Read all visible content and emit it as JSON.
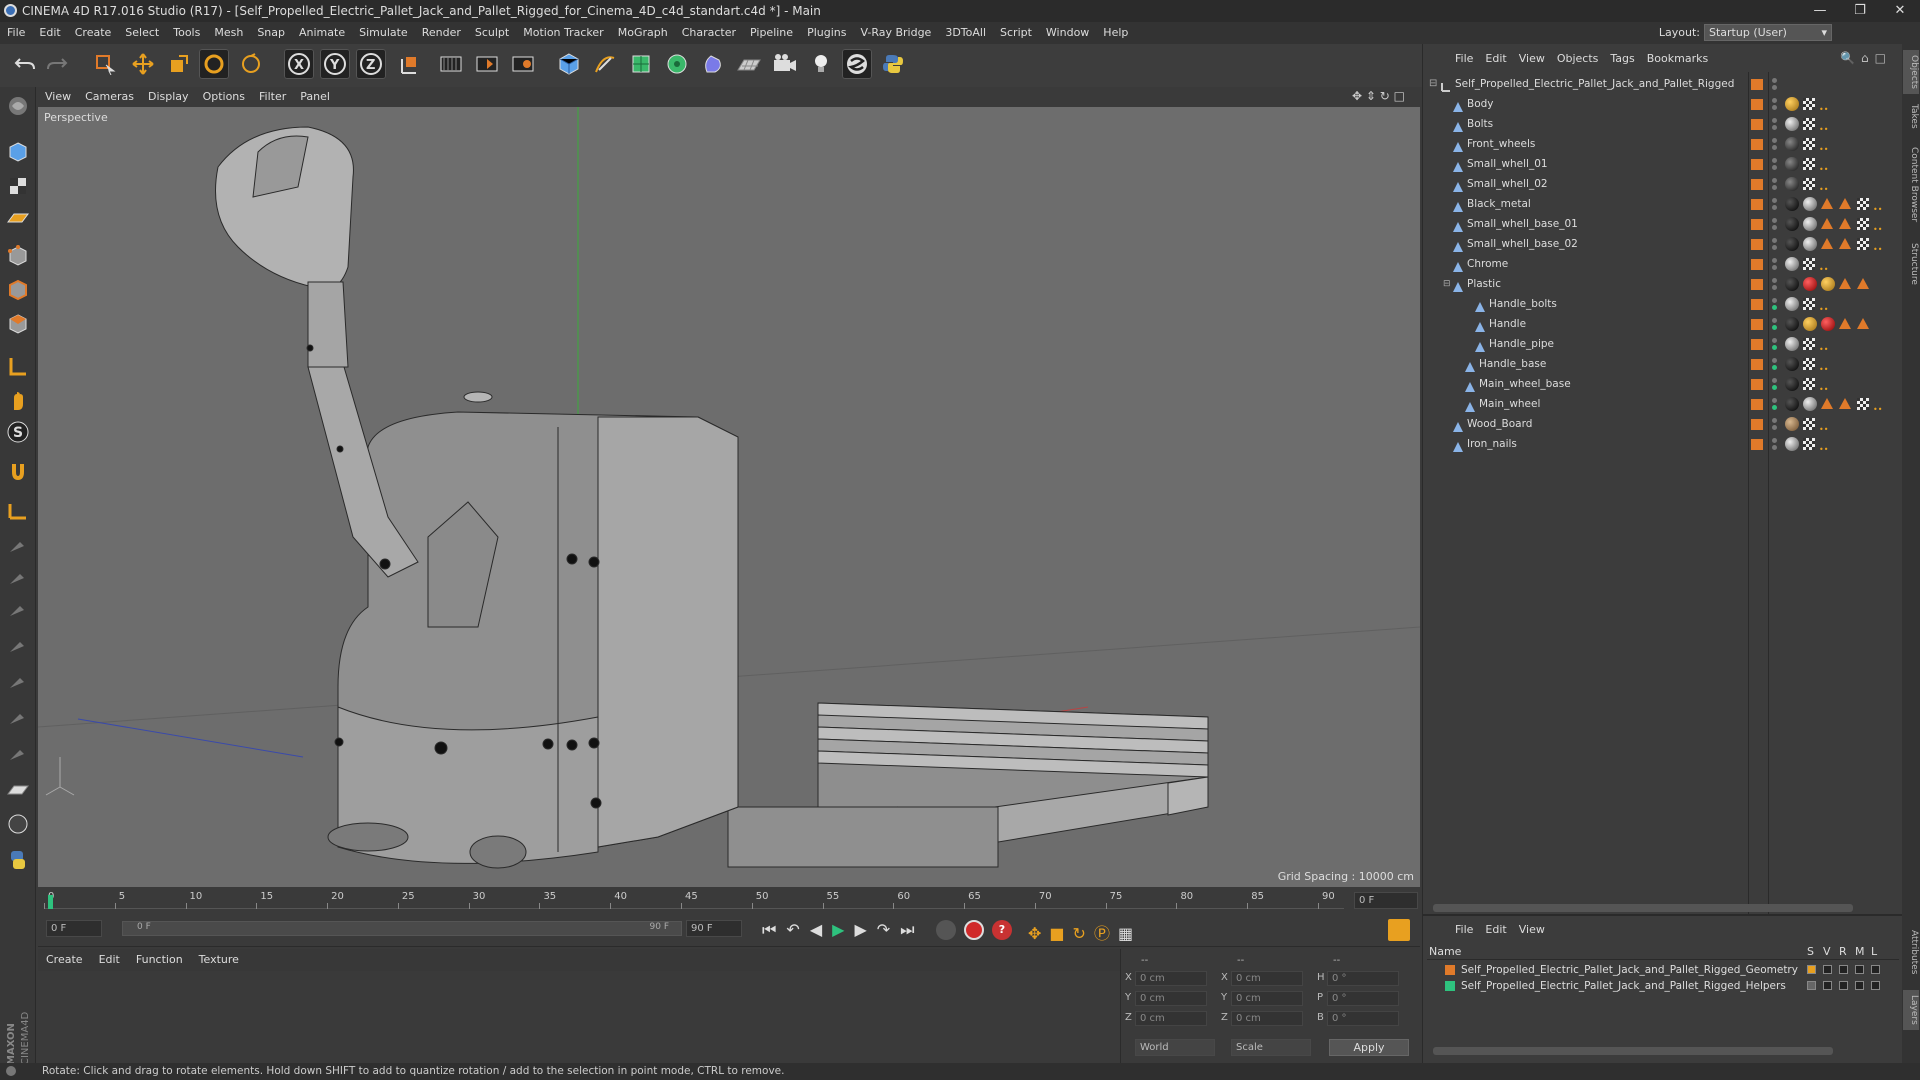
{
  "app": {
    "title": "CINEMA 4D R17.016 Studio (R17) - [Self_Propelled_Electric_Pallet_Jack_and_Pallet_Rigged_for_Cinema_4D_c4d_standart.c4d *] - Main",
    "layout_label": "Layout:",
    "layout_value": "Startup (User)"
  },
  "menubar": [
    "File",
    "Edit",
    "Create",
    "Select",
    "Tools",
    "Mesh",
    "Snap",
    "Animate",
    "Simulate",
    "Render",
    "Sculpt",
    "Motion Tracker",
    "MoGraph",
    "Character",
    "Pipeline",
    "Plugins",
    "V-Ray Bridge",
    "3DToAll",
    "Script",
    "Window",
    "Help"
  ],
  "viewport": {
    "menu": [
      "View",
      "Cameras",
      "Display",
      "Options",
      "Filter",
      "Panel"
    ],
    "label": "Perspective",
    "grid_spacing": "Grid Spacing : 10000 cm"
  },
  "timeline": {
    "ticks": [
      "0",
      "5",
      "10",
      "15",
      "20",
      "25",
      "30",
      "35",
      "40",
      "45",
      "50",
      "55",
      "60",
      "65",
      "70",
      "75",
      "80",
      "85",
      "90"
    ],
    "current_frame": "0 F",
    "start_field": "0 F",
    "range_left": "0 F",
    "range_right": "90 F",
    "end_field": "90 F"
  },
  "material_menu": [
    "Create",
    "Edit",
    "Function",
    "Texture"
  ],
  "coords": {
    "header": [
      "--",
      "--",
      "--"
    ],
    "rows": [
      {
        "a": "X",
        "v1": "0 cm",
        "b": "X",
        "v2": "0 cm",
        "c": "H",
        "v3": "0 °"
      },
      {
        "a": "Y",
        "v1": "0 cm",
        "b": "Y",
        "v2": "0 cm",
        "c": "P",
        "v3": "0 °"
      },
      {
        "a": "Z",
        "v1": "0 cm",
        "b": "Z",
        "v2": "0 cm",
        "c": "B",
        "v3": "0 °"
      }
    ],
    "space": "World",
    "mode": "Scale",
    "apply": "Apply"
  },
  "status": "Rotate: Click and drag to rotate elements. Hold down SHIFT to add to quantize rotation / add to the selection in point mode, CTRL to remove.",
  "object_manager": {
    "menu": [
      "File",
      "Edit",
      "View",
      "Objects",
      "Tags",
      "Bookmarks"
    ],
    "objects": [
      {
        "name": "Self_Propelled_Electric_Pallet_Jack_and_Pallet_Rigged",
        "depth": 0,
        "tags": []
      },
      {
        "name": "Body",
        "depth": 1,
        "tags": [
          "gold",
          "chk"
        ]
      },
      {
        "name": "Bolts",
        "depth": 1,
        "tags": [
          "grey",
          "chk"
        ]
      },
      {
        "name": "Front_wheels",
        "depth": 1,
        "tags": [
          "dark",
          "chk"
        ]
      },
      {
        "name": "Small_whell_01",
        "depth": 1,
        "tags": [
          "dark",
          "chk"
        ]
      },
      {
        "name": "Small_whell_02",
        "depth": 1,
        "tags": [
          "dark",
          "chk"
        ]
      },
      {
        "name": "Black_metal",
        "depth": 1,
        "tags": [
          "black",
          "grey",
          "tri",
          "tri",
          "chk"
        ]
      },
      {
        "name": "Small_whell_base_01",
        "depth": 1,
        "tags": [
          "black",
          "grey",
          "tri",
          "tri",
          "chk"
        ]
      },
      {
        "name": "Small_whell_base_02",
        "depth": 1,
        "tags": [
          "black",
          "grey",
          "tri",
          "tri",
          "chk"
        ]
      },
      {
        "name": "Chrome",
        "depth": 1,
        "tags": [
          "grey",
          "chk"
        ]
      },
      {
        "name": "Plastic",
        "depth": 1,
        "tags": [
          "black",
          "red",
          "gold",
          "tri",
          "tri"
        ]
      },
      {
        "name": "Handle_bolts",
        "depth": 3,
        "tags": [
          "grey",
          "chk"
        ]
      },
      {
        "name": "Handle",
        "depth": 3,
        "tags": [
          "black",
          "gold",
          "red",
          "tri",
          "tri"
        ]
      },
      {
        "name": "Handle_pipe",
        "depth": 3,
        "tags": [
          "grey",
          "chk"
        ]
      },
      {
        "name": "Handle_base",
        "depth": 2,
        "tags": [
          "black",
          "chk"
        ]
      },
      {
        "name": "Main_wheel_base",
        "depth": 2,
        "tags": [
          "black",
          "chk"
        ]
      },
      {
        "name": "Main_wheel",
        "depth": 2,
        "tags": [
          "black",
          "grey",
          "tri",
          "tri",
          "chk"
        ]
      },
      {
        "name": "Wood_Board",
        "depth": 1,
        "tags": [
          "wood",
          "chk"
        ]
      },
      {
        "name": "Iron_nails",
        "depth": 1,
        "tags": [
          "grey",
          "chk"
        ]
      }
    ]
  },
  "layer_manager": {
    "menu": [
      "File",
      "Edit",
      "View"
    ],
    "columns": [
      "Name",
      "S",
      "V",
      "R",
      "M",
      "L"
    ],
    "layers": [
      {
        "name": "Self_Propelled_Electric_Pallet_Jack_and_Pallet_Rigged_Geometry",
        "color": "#e07a2a"
      },
      {
        "name": "Self_Propelled_Electric_Pallet_Jack_and_Pallet_Rigged_Helpers",
        "color": "#2ec27e"
      }
    ]
  },
  "right_tabs": [
    "Objects",
    "Takes",
    "Content Browser",
    "Structure",
    "Attributes",
    "Layers"
  ],
  "colors": {
    "accent": "#e07a2a",
    "viewport_bg": "#6d6d6d",
    "panel_bg": "#3c3c3c"
  }
}
